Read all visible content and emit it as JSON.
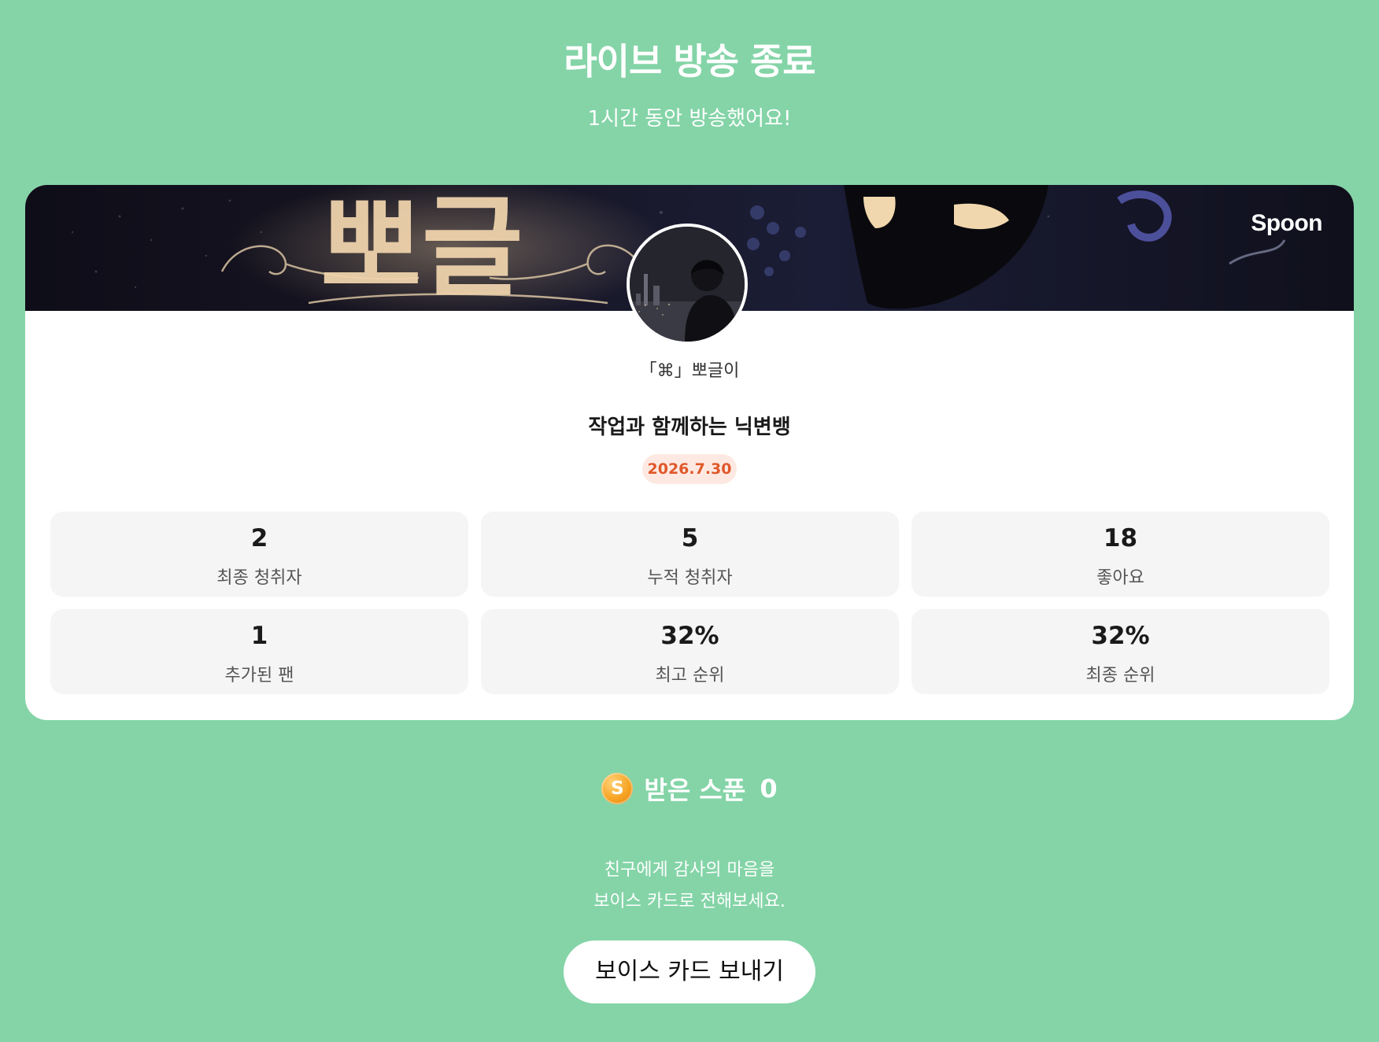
{
  "header": {
    "title": "라이브 방송 종료",
    "subtitle": "1시간 동안 방송했어요!"
  },
  "card": {
    "banner_text": "뽀글",
    "brand_logo": "Spoon",
    "host_name": "「⌘」뽀글이",
    "stream_title": "작업과 함께하는 닉변뱅",
    "date": "2026.7.30",
    "stats": [
      {
        "value": "2",
        "label": "최종 청취자"
      },
      {
        "value": "5",
        "label": "누적 청취자"
      },
      {
        "value": "18",
        "label": "좋아요"
      },
      {
        "value": "1",
        "label": "추가된 팬"
      },
      {
        "value": "32%",
        "label": "최고 순위"
      },
      {
        "value": "32%",
        "label": "최종 순위"
      }
    ]
  },
  "spoons": {
    "coin_letter": "S",
    "label": "받은 스푼",
    "count": "0"
  },
  "voice_card": {
    "message_line1": "친구에게 감사의 마음을",
    "message_line2": "보이스 카드로 전해보세요.",
    "button_label": "보이스 카드 보내기"
  },
  "colors": {
    "background": "#84d4a7",
    "card": "#ffffff",
    "badge_bg": "#fde9e2",
    "badge_text": "#e0582a",
    "coin": "#f7a423"
  }
}
